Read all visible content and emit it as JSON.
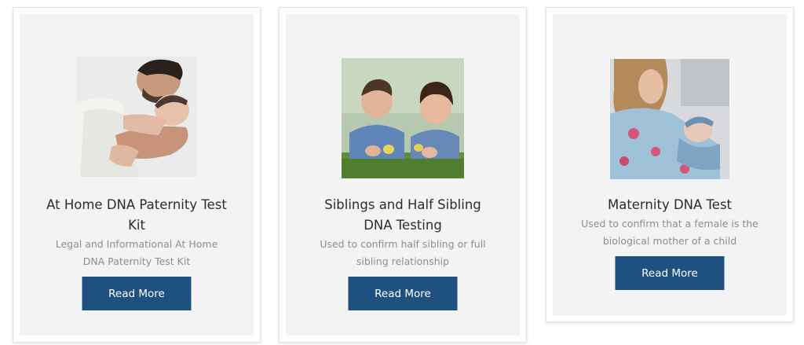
{
  "cards": [
    {
      "title_lines": [
        "At Home DNA Paternity Test",
        "Kit"
      ],
      "desc_lines": [
        "Legal and Informational At Home",
        "DNA Paternity Test Kit"
      ],
      "button_label": "Read More",
      "image": "father-holding-baby-photo"
    },
    {
      "title_lines": [
        "Siblings and Half Sibling",
        "DNA Testing"
      ],
      "desc_lines": [
        "Used to confirm half sibling or full",
        "sibling relationship"
      ],
      "button_label": "Read More",
      "image": "two-children-with-ducklings-photo"
    },
    {
      "title_lines": [
        "Maternity DNA Test"
      ],
      "desc_lines": [
        "Used to confirm that a female is the",
        "biological mother of a child"
      ],
      "button_label": "Read More",
      "image": "mother-holding-newborn-photo"
    }
  ],
  "colors": {
    "button_bg": "#1e5080",
    "card_inner_bg": "#f4f3f4",
    "title": "#2b2b33",
    "desc": "#8d8d8d"
  }
}
